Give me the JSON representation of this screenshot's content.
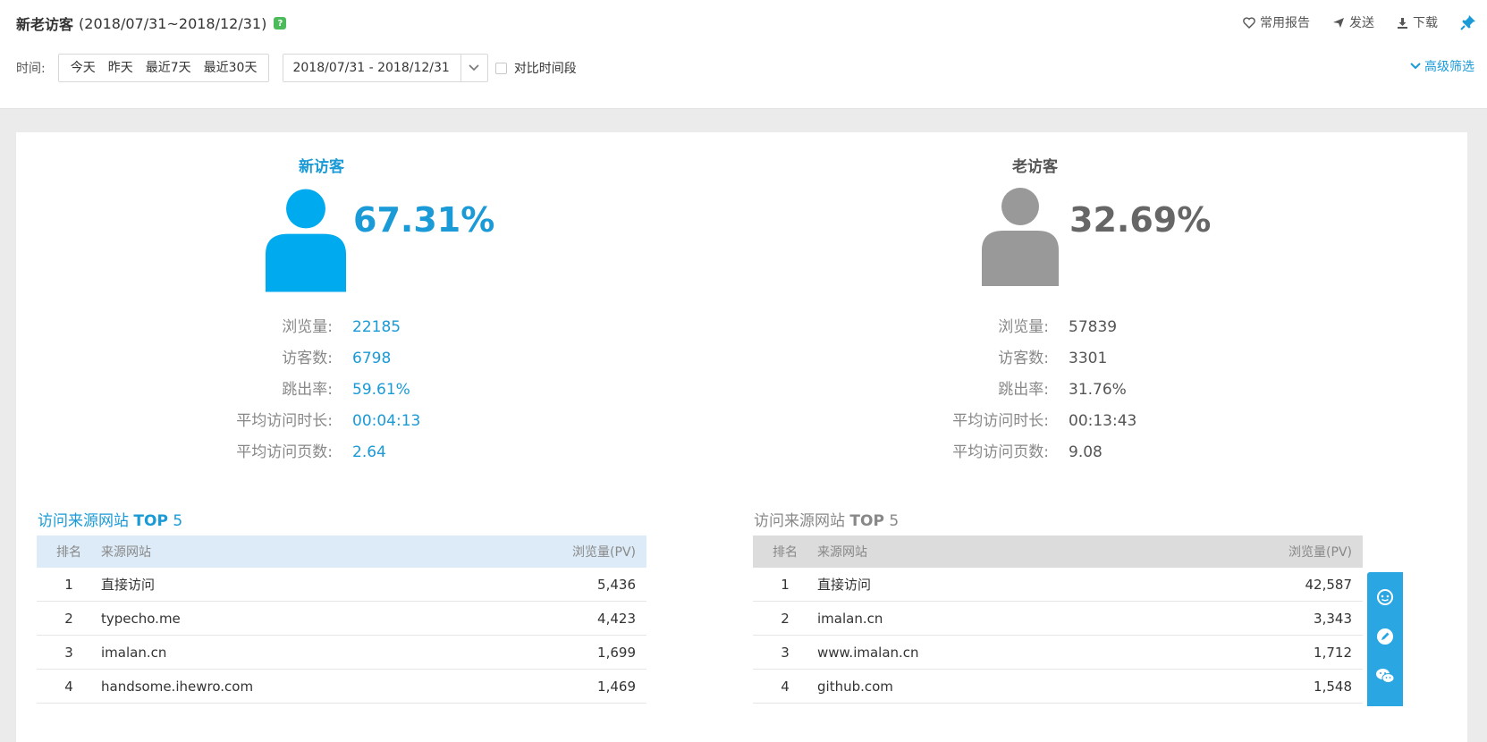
{
  "header": {
    "title": "新老访客",
    "range": "(2018/07/31~2018/12/31)",
    "help_badge": "?",
    "actions": {
      "favorite": "常用报告",
      "send": "发送",
      "download": "下载"
    }
  },
  "filter": {
    "time_label": "时间:",
    "quick_ranges": [
      "今天",
      "昨天",
      "最近7天",
      "最近30天"
    ],
    "date_range": "2018/07/31 - 2018/12/31",
    "compare_label": "对比时间段",
    "advanced_filter": "高级筛选"
  },
  "new_visitor": {
    "title": "新访客",
    "percent": "67.31%",
    "stats": [
      {
        "label": "浏览量:",
        "value": "22185"
      },
      {
        "label": "访客数:",
        "value": "6798"
      },
      {
        "label": "跳出率:",
        "value": "59.61%"
      },
      {
        "label": "平均访问时长:",
        "value": "00:04:13"
      },
      {
        "label": "平均访问页数:",
        "value": "2.64"
      }
    ],
    "top_title_prefix": "访问来源网站 ",
    "top_title_bold": "TOP",
    "top_title_suffix": " 5",
    "table_headers": {
      "rank": "排名",
      "site": "来源网站",
      "pv": "浏览量(PV)"
    },
    "rows": [
      {
        "rank": "1",
        "site": "直接访问",
        "pv": "5,436"
      },
      {
        "rank": "2",
        "site": "typecho.me",
        "pv": "4,423"
      },
      {
        "rank": "3",
        "site": "imalan.cn",
        "pv": "1,699"
      },
      {
        "rank": "4",
        "site": "handsome.ihewro.com",
        "pv": "1,469"
      }
    ]
  },
  "old_visitor": {
    "title": "老访客",
    "percent": "32.69%",
    "stats": [
      {
        "label": "浏览量:",
        "value": "57839"
      },
      {
        "label": "访客数:",
        "value": "3301"
      },
      {
        "label": "跳出率:",
        "value": "31.76%"
      },
      {
        "label": "平均访问时长:",
        "value": "00:13:43"
      },
      {
        "label": "平均访问页数:",
        "value": "9.08"
      }
    ],
    "top_title_prefix": "访问来源网站 ",
    "top_title_bold": "TOP",
    "top_title_suffix": " 5",
    "table_headers": {
      "rank": "排名",
      "site": "来源网站",
      "pv": "浏览量(PV)"
    },
    "rows": [
      {
        "rank": "1",
        "site": "直接访问",
        "pv": "42,587"
      },
      {
        "rank": "2",
        "site": "imalan.cn",
        "pv": "3,343"
      },
      {
        "rank": "3",
        "site": "www.imalan.cn",
        "pv": "1,712"
      },
      {
        "rank": "4",
        "site": "github.com",
        "pv": "1,548"
      }
    ]
  },
  "colors": {
    "accent": "#1a9ad6",
    "new_person": "#00aaee",
    "old_person": "#999999",
    "floatbar": "#2aa7e2"
  },
  "icons": [
    "heart-icon",
    "send-icon",
    "download-icon",
    "pin-icon",
    "chevron-down-icon",
    "person-icon",
    "chat-icon",
    "edit-icon",
    "wechat-icon"
  ]
}
